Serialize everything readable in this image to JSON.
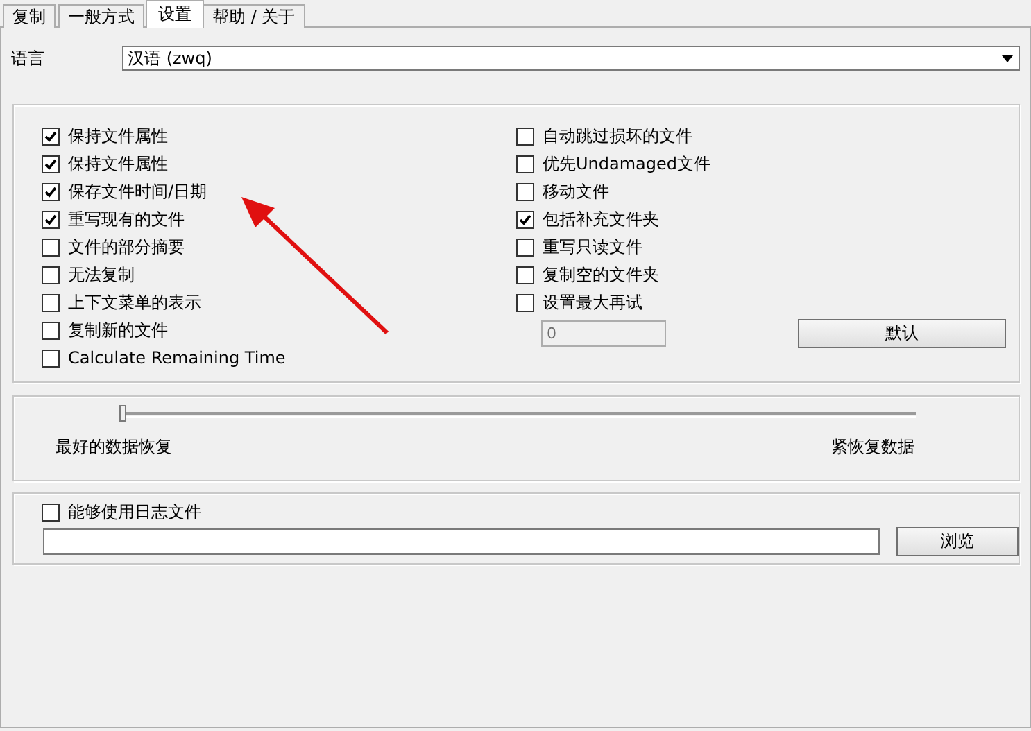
{
  "tabs": [
    {
      "label": "复制",
      "selected": false
    },
    {
      "label": "一般方式",
      "selected": false
    },
    {
      "label": "设置",
      "selected": true
    },
    {
      "label": "帮助 / 关于",
      "selected": false
    }
  ],
  "language": {
    "label": "语言",
    "value": "汉语 (zwq)"
  },
  "options_left": [
    {
      "label": "保持文件属性",
      "checked": true
    },
    {
      "label": "保持文件属性",
      "checked": true
    },
    {
      "label": "保存文件时间/日期",
      "checked": true
    },
    {
      "label": "重写现有的文件",
      "checked": true
    },
    {
      "label": "文件的部分摘要",
      "checked": false
    },
    {
      "label": "无法复制",
      "checked": false
    },
    {
      "label": "上下文菜单的表示",
      "checked": false
    },
    {
      "label": "复制新的文件",
      "checked": false
    },
    {
      "label": "Calculate Remaining Time",
      "checked": false
    }
  ],
  "options_right": [
    {
      "label": "自动跳过损坏的文件",
      "checked": false
    },
    {
      "label": "优先Undamaged文件",
      "checked": false
    },
    {
      "label": "移动文件",
      "checked": false
    },
    {
      "label": "包括补充文件夹",
      "checked": true
    },
    {
      "label": "重写只读文件",
      "checked": false
    },
    {
      "label": "复制空的文件夹",
      "checked": false
    },
    {
      "label": "设置最大再试",
      "checked": false
    }
  ],
  "retry_field": {
    "value": "0",
    "disabled": true
  },
  "default_button": "默认",
  "recovery_slider": {
    "level": 0,
    "left_label": "最好的数据恢复",
    "right_label": "紧恢复数据"
  },
  "log": {
    "label": "能够使用日志文件",
    "checked": false,
    "browse_button": "浏览"
  }
}
